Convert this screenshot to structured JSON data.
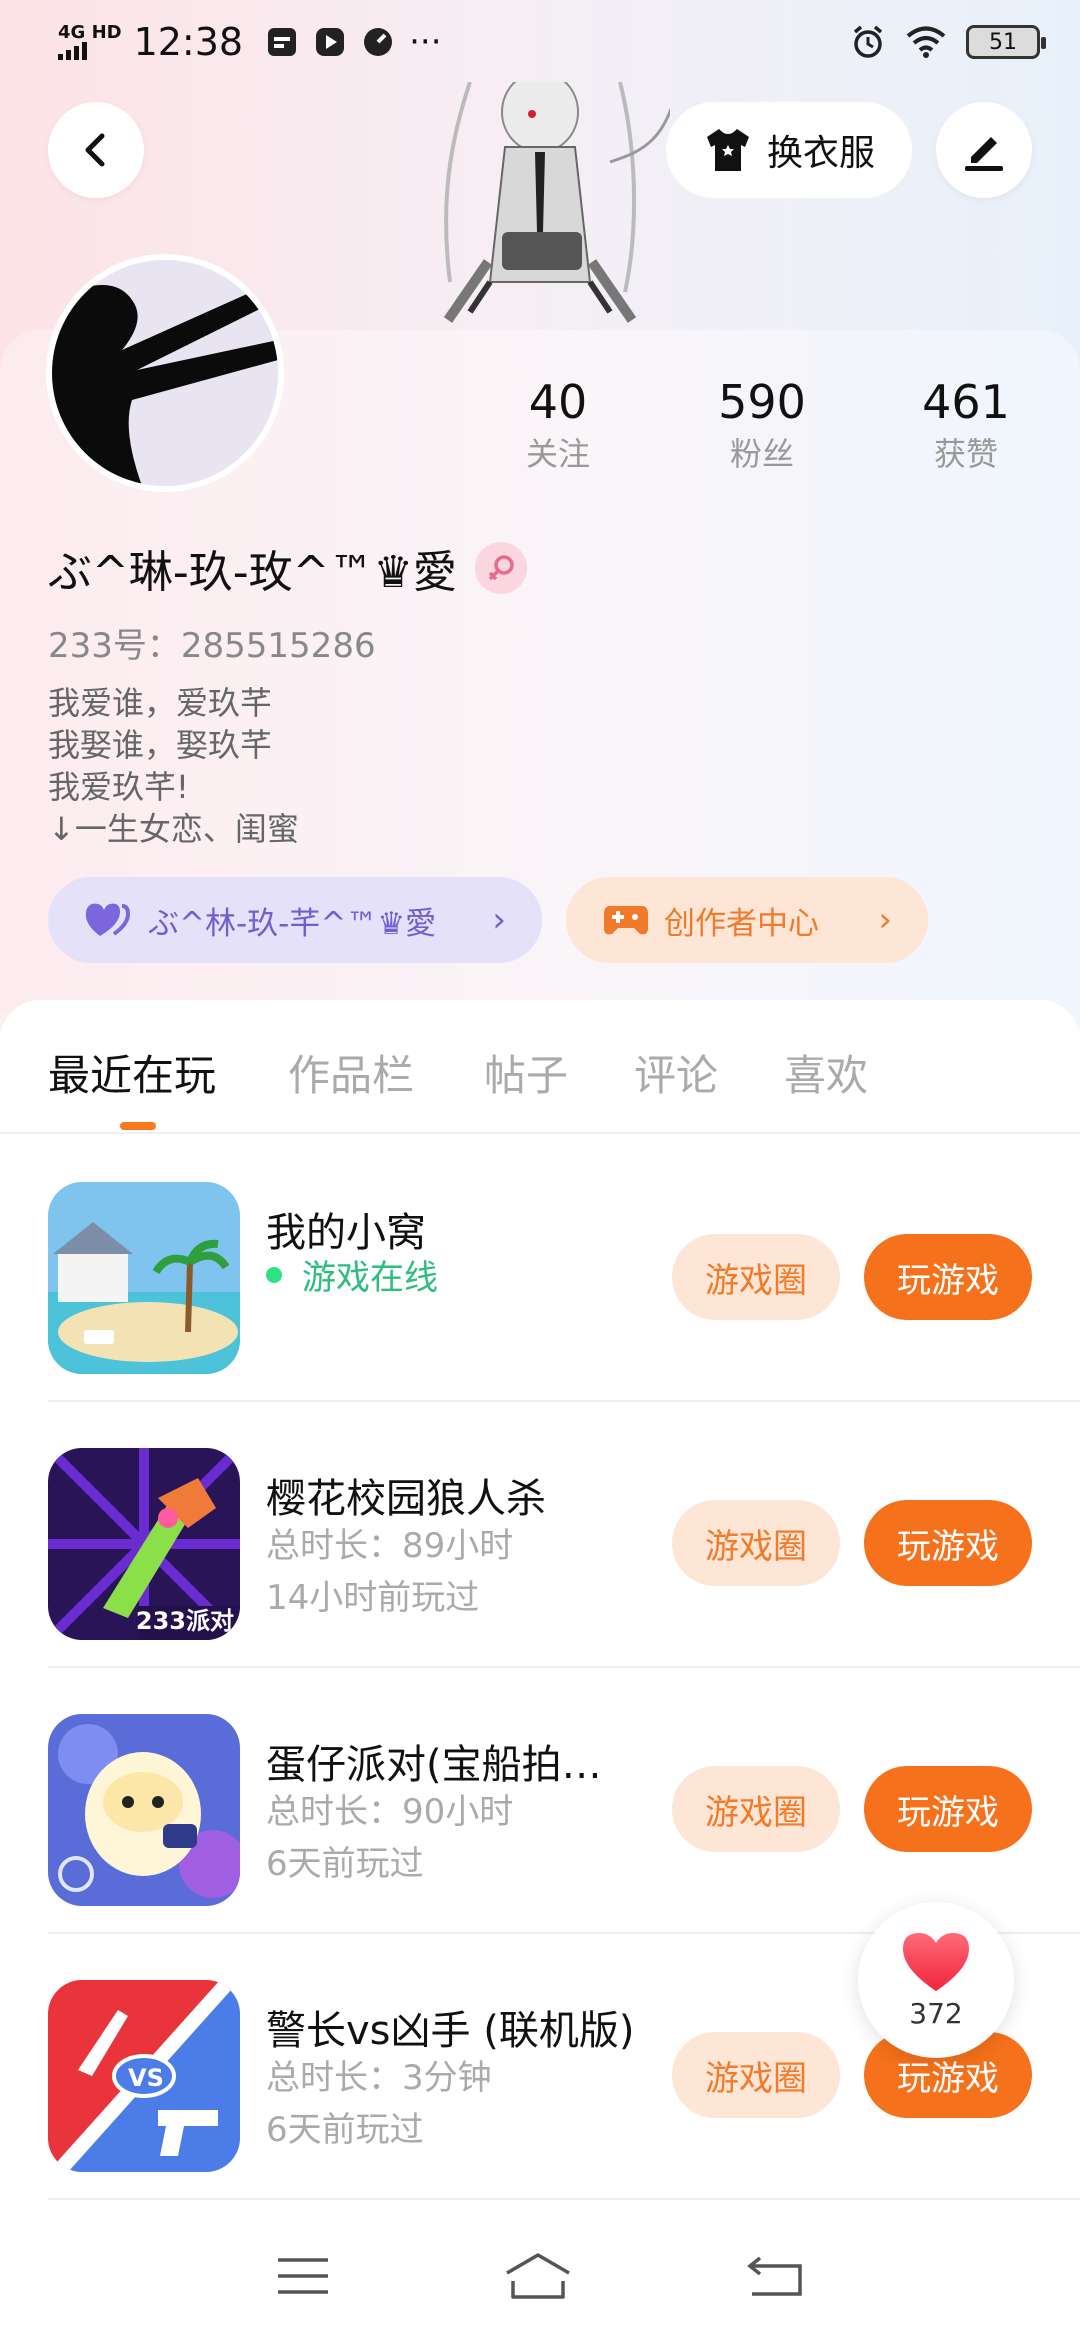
{
  "status_bar": {
    "network": "4G HD",
    "time": "12:38",
    "more": "···",
    "battery": "51"
  },
  "header": {
    "outfit_label": "换衣服"
  },
  "profile": {
    "stats": [
      {
        "value": "40",
        "label": "关注"
      },
      {
        "value": "590",
        "label": "粉丝"
      },
      {
        "value": "461",
        "label": "获赞"
      }
    ],
    "nickname": "ぶ^琳-玖-玫^™♛愛",
    "uid": "233号：285515286",
    "bio": [
      "我爱谁，爱玖芊",
      "我娶谁，娶玖芊",
      "我爱玖芊!",
      "↓一生女恋、闺蜜"
    ],
    "tag_purple": "ぶ^林-玖-芊^™♛愛",
    "tag_orange": "创作者中心"
  },
  "tabs": [
    "最近在玩",
    "作品栏",
    "帖子",
    "评论",
    "喜欢"
  ],
  "games": [
    {
      "title": "我的小窝",
      "line1": "游戏在线",
      "line2": "",
      "circle_label": "游戏圈",
      "play_label": "玩游戏"
    },
    {
      "title": "樱花校园狼人杀",
      "line1": "总时长：89小时",
      "line2": "14小时前玩过",
      "circle_label": "游戏圈",
      "play_label": "玩游戏",
      "badge": "233派对"
    },
    {
      "title": "蛋仔派对(宝船拍…",
      "line1": "总时长：90小时",
      "line2": "6天前玩过",
      "circle_label": "游戏圈",
      "play_label": "玩游戏"
    },
    {
      "title": "警长vs凶手 (联机版)",
      "line1": "总时长：3分钟",
      "line2": "6天前玩过",
      "circle_label": "游戏圈",
      "play_label": "玩游戏",
      "badge": "VS"
    }
  ],
  "like_float": {
    "count": "372"
  },
  "colors": {
    "accent": "#f5711b",
    "online": "#2fbd7f",
    "purple": "#6f5fd0"
  }
}
